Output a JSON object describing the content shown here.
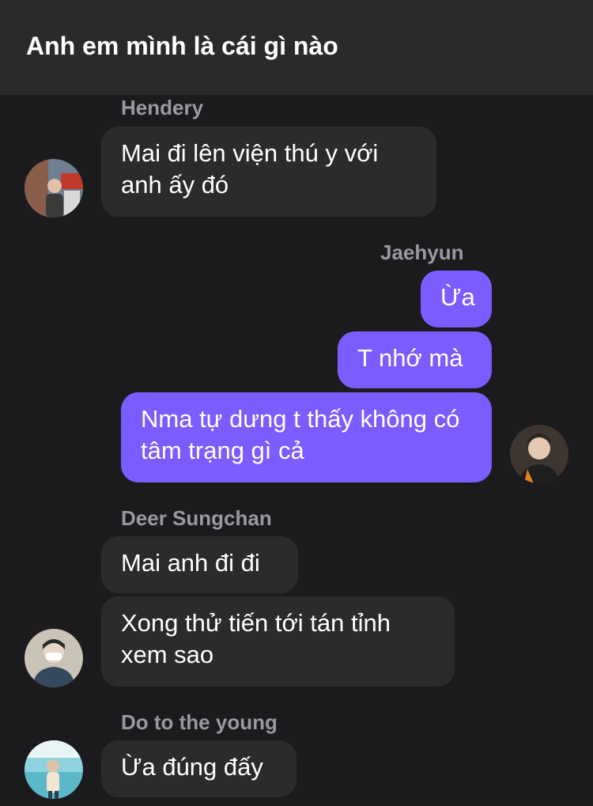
{
  "header": {
    "title": "Anh em mình là cái gì nào"
  },
  "messages": [
    {
      "sender": "Hendery",
      "texts": [
        "Mai đi lên viện thú y với anh ấy đó"
      ]
    },
    {
      "sender": "Jaehyun",
      "texts": [
        "Ừa",
        "T nhớ mà",
        "Nma tự dưng t thấy không có tâm trạng gì cả"
      ]
    },
    {
      "sender": "Deer Sungchan",
      "texts": [
        "Mai anh đi đi",
        "Xong thử tiến tới tán tỉnh xem sao"
      ]
    },
    {
      "sender": "Do to the young",
      "texts": [
        "Ừa đúng đấy"
      ]
    }
  ],
  "colors": {
    "background": "#1b1b1d",
    "header": "#2a2a2c",
    "incoming_bubble": "#2b2b2e",
    "outgoing_bubble": "#7b5cff",
    "sender_name": "#9a9a9e"
  }
}
